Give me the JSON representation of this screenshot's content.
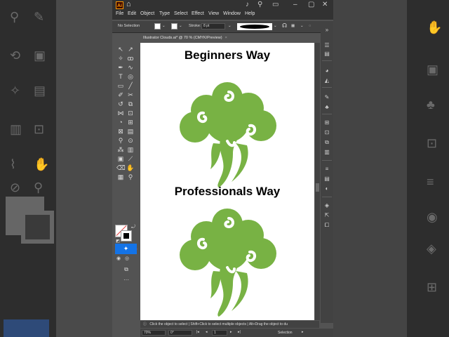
{
  "app": {
    "logo": "Ai",
    "menu": [
      "File",
      "Edit",
      "Object",
      "Type",
      "Select",
      "Effect",
      "View",
      "Window",
      "Help"
    ]
  },
  "control_bar": {
    "selection_label": "No Selection",
    "stroke_label": "Stroke:",
    "stroke_weight": "8 pt"
  },
  "document": {
    "tab_title": "Illustrator Clouds.ai* @ 70 % (CMYK/Preview)",
    "close": "×"
  },
  "artboard": {
    "heading_top": "Beginners Way",
    "heading_bottom": "Professionals Way",
    "cloud_color": "#78b244"
  },
  "status": {
    "hint": "Click the object to select | Shift+Click to select multiple objects | Alt+Drag the object to du",
    "zoom": "70%",
    "rotation": "0°",
    "artboard_num": "1",
    "mode": "Selection"
  },
  "colors": {
    "accent": "#1473e6",
    "panel_bg": "#535353",
    "chrome_bg": "#323232"
  }
}
